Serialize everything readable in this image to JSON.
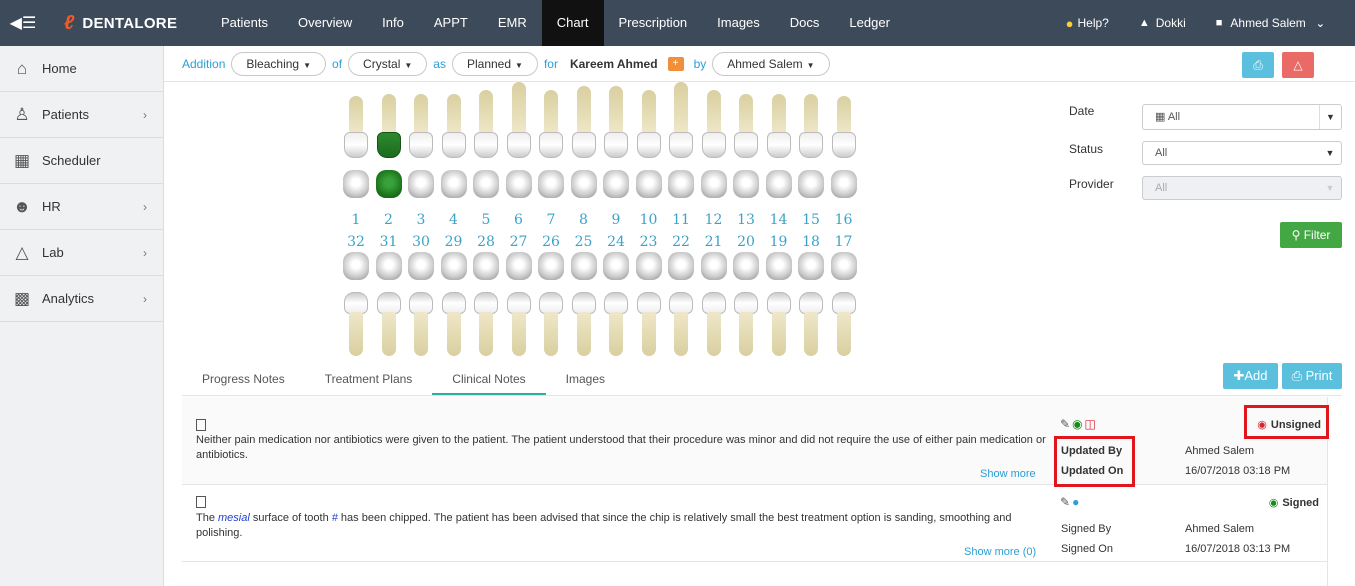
{
  "topbar": {
    "brand": "DENTALORE",
    "nav": [
      "Patients",
      "Overview",
      "Info",
      "APPT",
      "EMR",
      "Chart",
      "Prescription",
      "Images",
      "Docs",
      "Ledger"
    ],
    "active_nav": "Chart",
    "help": "Help?",
    "clinic": "Dokki",
    "user": "Ahmed Salem"
  },
  "sidebar": {
    "items": [
      {
        "label": "Home",
        "icon": "home-icon",
        "has_children": false
      },
      {
        "label": "Patients",
        "icon": "person-icon",
        "has_children": true
      },
      {
        "label": "Scheduler",
        "icon": "calendar-icon",
        "has_children": false
      },
      {
        "label": "HR",
        "icon": "users-icon",
        "has_children": true
      },
      {
        "label": "Lab",
        "icon": "flask-icon",
        "has_children": true
      },
      {
        "label": "Analytics",
        "icon": "bar-chart-icon",
        "has_children": true
      }
    ]
  },
  "addition_bar": {
    "label_addition": "Addition",
    "procedure": "Bleaching",
    "label_of": "of",
    "material": "Crystal",
    "label_as": "as",
    "status": "Planned",
    "label_for": "for",
    "patient": "Kareem Ahmed",
    "label_by": "by",
    "provider": "Ahmed Salem"
  },
  "teeth": {
    "upper": [
      "1",
      "2",
      "3",
      "4",
      "5",
      "6",
      "7",
      "8",
      "9",
      "10",
      "11",
      "12",
      "13",
      "14",
      "15",
      "16"
    ],
    "lower": [
      "32",
      "31",
      "30",
      "29",
      "28",
      "27",
      "26",
      "25",
      "24",
      "23",
      "22",
      "21",
      "20",
      "19",
      "18",
      "17"
    ],
    "highlighted": [
      "2"
    ],
    "highlight_color": "#1c6b1c"
  },
  "filters": {
    "date_label": "Date",
    "date_value": "All",
    "status_label": "Status",
    "status_value": "All",
    "provider_label": "Provider",
    "provider_value": "All",
    "filter_button": "Filter"
  },
  "tabs": {
    "items": [
      "Progress Notes",
      "Treatment Plans",
      "Clinical Notes",
      "Images"
    ],
    "active": "Clinical Notes",
    "add_button": "Add",
    "print_button": "Print"
  },
  "notes": [
    {
      "text": "Neither pain medication nor antibiotics were given to the patient. The patient understood that their procedure was minor and did not require the use of either pain medication or antibiotics.",
      "show_more": "Show more",
      "status": "Unsigned",
      "label1": "Updated By",
      "value1": "Ahmed Salem",
      "label2": "Updated On",
      "value2": "16/07/2018 03:18 PM"
    },
    {
      "text_pre": "The ",
      "text_hl1": "mesial",
      "text_mid": " surface of tooth ",
      "text_hl2": "#",
      "text_post": " has been chipped. The patient has been advised that since the chip is relatively small the best treatment option is sanding, smoothing and polishing.",
      "show_more": "Show more (0)",
      "status": "Signed",
      "label1": "Signed By",
      "value1": "Ahmed Salem",
      "label2": "Signed On",
      "value2": "16/07/2018 03:13 PM"
    }
  ]
}
